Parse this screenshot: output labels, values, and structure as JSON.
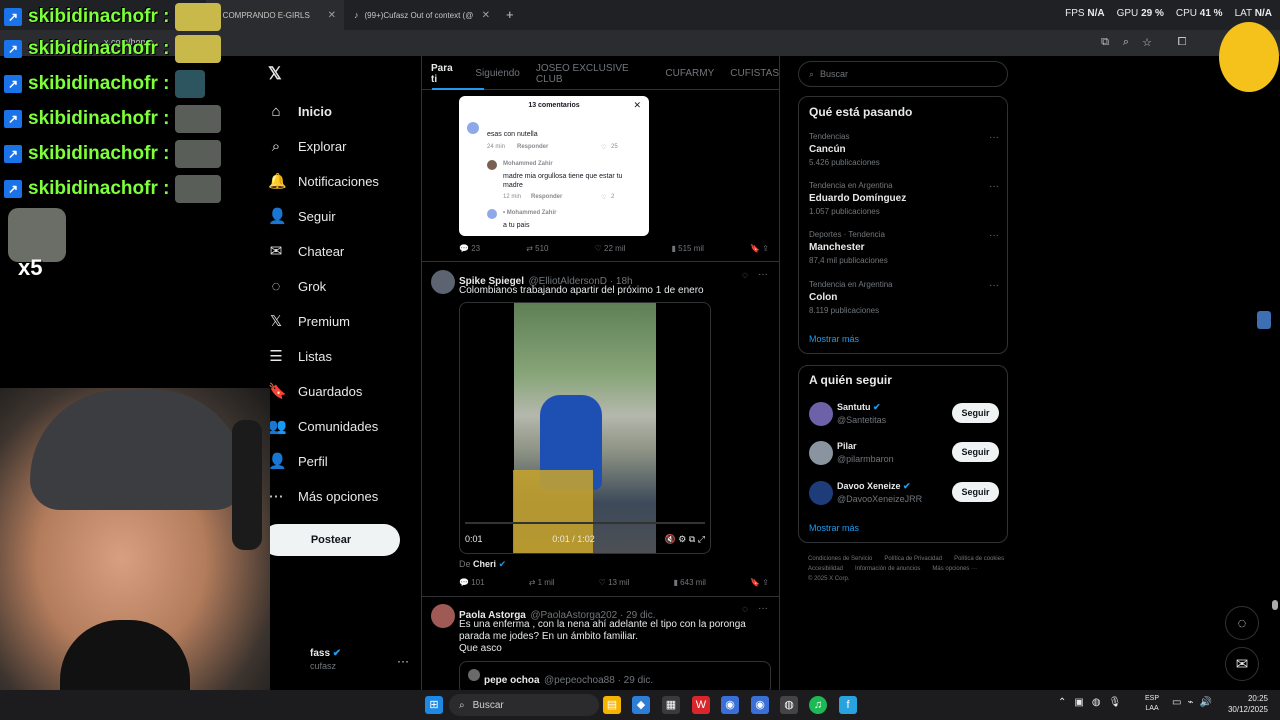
{
  "browser": {
    "tabs": [
      {
        "label": "COMPRANDO E-GIRLS",
        "prefix": ")"
      },
      {
        "label": "(99+)Cufasz Out of context (@"
      }
    ],
    "new_tab": "+",
    "url": "x.com/home",
    "stats": {
      "fps_label": "FPS",
      "fps_value": "N/A",
      "gpu_label": "GPU",
      "gpu_value": "29 %",
      "cpu_label": "CPU",
      "cpu_value": "41 %",
      "lat_label": "LAT",
      "lat_value": "N/A"
    }
  },
  "chat": {
    "rows": [
      "skibidinachofr :",
      "skibidinachofr :",
      "skibidinachofr :",
      "skibidinachofr :",
      "skibidinachofr :",
      "skibidinachofr :"
    ],
    "multiplier": "x5"
  },
  "nav": {
    "items": [
      {
        "label": "Inicio",
        "icon": "home-icon",
        "glyph": "⌂"
      },
      {
        "label": "Explorar",
        "icon": "search-icon",
        "glyph": "⌕"
      },
      {
        "label": "Notificaciones",
        "icon": "bell-icon",
        "glyph": "🔔"
      },
      {
        "label": "Seguir",
        "icon": "follow-icon",
        "glyph": "👤"
      },
      {
        "label": "Chatear",
        "icon": "mail-icon",
        "glyph": "✉"
      },
      {
        "label": "Grok",
        "icon": "grok-icon",
        "glyph": "◌"
      },
      {
        "label": "Premium",
        "icon": "x-logo-icon",
        "glyph": "𝕏"
      },
      {
        "label": "Listas",
        "icon": "list-icon",
        "glyph": "☰"
      },
      {
        "label": "Guardados",
        "icon": "bookmark-icon",
        "glyph": "🔖"
      },
      {
        "label": "Comunidades",
        "icon": "communities-icon",
        "glyph": "👥"
      },
      {
        "label": "Perfil",
        "icon": "profile-icon",
        "glyph": "👤"
      },
      {
        "label": "Más opciones",
        "icon": "more-icon",
        "glyph": "⋯"
      }
    ],
    "post_button": "Postear",
    "account_name": "fass",
    "account_handle": "cufasz"
  },
  "feed": {
    "tabs": [
      "Para ti",
      "Siguiendo",
      "JOSEO EXCLUSIVE CLUB",
      "CUFARMY",
      "CUFISTAS"
    ],
    "card": {
      "title": "13 comentarios",
      "c1_text": "esas con nutella",
      "c1_time": "24 min",
      "c1_reply": "Responder",
      "c1_likes": "25",
      "c2_name": "Mohammed Zahir",
      "c2_text": "madre mia orgullosa tiene que estar tu madre",
      "c2_time": "12 min",
      "c2_reply": "Responder",
      "c2_likes": "2",
      "c3_name": "• Mohammed Zahir",
      "c3_text": "a tu pais"
    },
    "tweet1_actions": [
      "23",
      "510",
      "22 mil",
      "515 mil"
    ],
    "tweet2": {
      "name": "Spike Spiegel",
      "handle": "@ElliotAldersonD · 18h",
      "text": "Colombianos  trabajando apartir del próximo 1 de enero",
      "video_left": "0:01",
      "video_time": "0:01 / 1:02",
      "from_prefix": "De",
      "from_name": "Cheri",
      "actions": [
        "101",
        "1 mil",
        "13 mil",
        "643 mil"
      ]
    },
    "tweet3": {
      "name": "Paola Astorga",
      "handle": "@PaolaAstorga202 · 29 dic.",
      "text": "Es una enferma , con la nena ahí adelante el tipo con la poronga parada me jodes? En un ámbito familiar.",
      "text2": "Que asco",
      "quote_name": "pepe ochoa",
      "quote_handle": "@pepeochoa88 · 29 dic."
    }
  },
  "sidebar": {
    "search_placeholder": "Buscar",
    "trends_title": "Qué está pasando",
    "trends": [
      {
        "context": "Tendencias",
        "name": "Cancún",
        "count": "5.426 publicaciones"
      },
      {
        "context": "Tendencia en Argentina",
        "name": "Eduardo Domínguez",
        "count": "1.057 publicaciones"
      },
      {
        "context": "Deportes · Tendencia",
        "name": "Manchester",
        "count": "87,4 mil publicaciones"
      },
      {
        "context": "Tendencia en Argentina",
        "name": "Colon",
        "count": "8.119 publicaciones"
      }
    ],
    "show_more": "Mostrar más",
    "follow_title": "A quién seguir",
    "follow": [
      {
        "name": "Santutu",
        "handle": "@Santetitas",
        "button": "Seguir"
      },
      {
        "name": "Pilar",
        "handle": "@pilarmbaron",
        "button": "Seguir"
      },
      {
        "name": "Davoo Xeneize",
        "handle": "@DavooXeneizeJRR",
        "button": "Seguir"
      }
    ],
    "show_more2": "Mostrar más",
    "footer": [
      "Condiciones de Servicio",
      "Política de Privacidad",
      "Política de cookies",
      "Accesibilidad",
      "Información de anuncios",
      "Más opciones ···",
      "© 2025 X Corp."
    ]
  },
  "taskbar": {
    "search": "Buscar",
    "lang_top": "ESP",
    "lang_bottom": "LAA",
    "time": "20:25",
    "date": "30/12/2025"
  },
  "colors": {
    "accent": "#1d9bf0",
    "chat_name": "#7dff3a",
    "background": "#000000"
  }
}
